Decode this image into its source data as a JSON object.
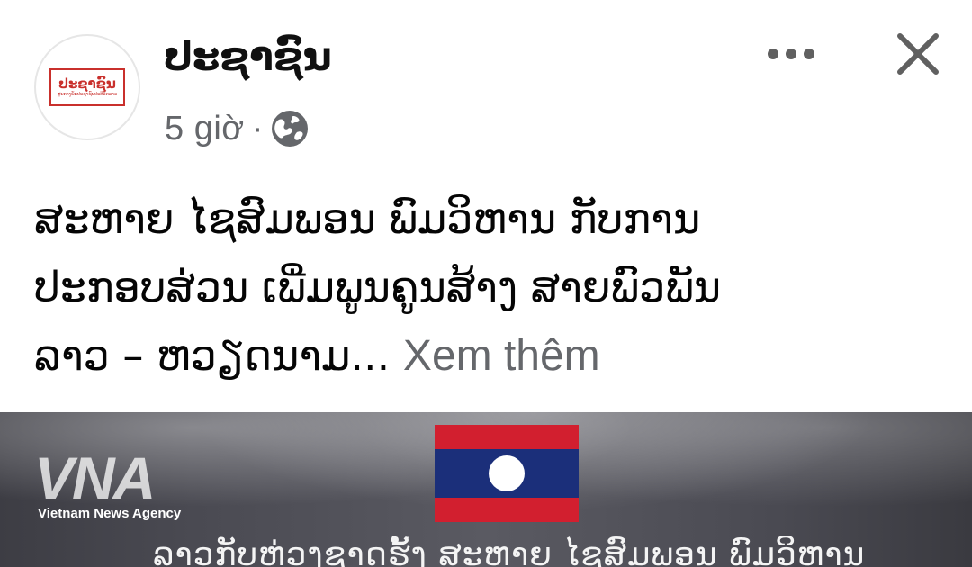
{
  "post": {
    "page_name": "ປະຊາຊົນ",
    "avatar": {
      "logo_text": "ປະຊາຊົນ",
      "tagline": "ສູນກາງພັກປະຊາຊົນປະຕິວັດລາວ"
    },
    "time": "5 giờ",
    "separator": "·",
    "audience_icon": "globe-icon",
    "text_lines": [
      "ສະຫາຍ ໄຊສົມພອນ ພົມວິຫານ ກັບການ",
      "ປະກອບສ່ວນ ເພີ່ມພູນຄູນສ້າງ ສາຍພົວພັນ",
      "ລາວ – ຫວຽດນາມ..."
    ],
    "see_more_label": "Xem thêm"
  },
  "media": {
    "watermark_logo": "VNA",
    "watermark_caption": "Vietnam News Agency",
    "banner_text": "ລາວກັບຫ່ວງຊາດຮັ້ງ ສະຫາຍ ໄຊສົມພອນ ພົມວິຫານ"
  },
  "colors": {
    "text_primary": "#050505",
    "text_secondary": "#65676b",
    "flag_red": "#d21f2f",
    "flag_blue": "#1b2f7a"
  }
}
